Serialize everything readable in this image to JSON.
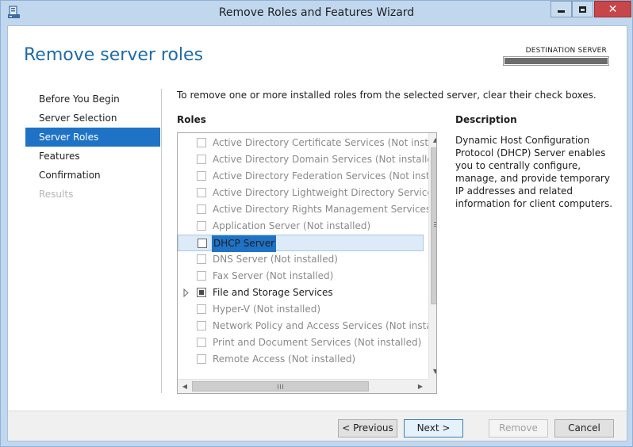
{
  "window": {
    "title": "Remove Roles and Features Wizard",
    "close_glyph": "✕"
  },
  "header": {
    "page_title": "Remove server roles",
    "destination_label": "DESTINATION SERVER"
  },
  "nav": {
    "items": [
      {
        "label": "Before You Begin",
        "state": "normal"
      },
      {
        "label": "Server Selection",
        "state": "normal"
      },
      {
        "label": "Server Roles",
        "state": "active"
      },
      {
        "label": "Features",
        "state": "normal"
      },
      {
        "label": "Confirmation",
        "state": "normal"
      },
      {
        "label": "Results",
        "state": "disabled"
      }
    ]
  },
  "main": {
    "instruction": "To remove one or more installed roles from the selected server, clear their check boxes.",
    "roles_heading": "Roles",
    "description_heading": "Description",
    "description_text": "Dynamic Host Configuration Protocol (DHCP) Server enables you to centrally configure, manage, and provide temporary IP addresses and related information for client computers."
  },
  "roles": [
    {
      "label": "Active Directory Certificate Services (Not installed)"
    },
    {
      "label": "Active Directory Domain Services (Not installed)"
    },
    {
      "label": "Active Directory Federation Services (Not installed)"
    },
    {
      "label": "Active Directory Lightweight Directory Services (N"
    },
    {
      "label": "Active Directory Rights Management Services (Not"
    },
    {
      "label": "Application Server (Not installed)"
    },
    {
      "label": "DHCP Server"
    },
    {
      "label": "DNS Server (Not installed)"
    },
    {
      "label": "Fax Server (Not installed)"
    },
    {
      "label": "File and Storage Services"
    },
    {
      "label": "Hyper-V (Not installed)"
    },
    {
      "label": "Network Policy and Access Services (Not installed)"
    },
    {
      "label": "Print and Document Services (Not installed)"
    },
    {
      "label": "Remote Access (Not installed)"
    }
  ],
  "scroll": {
    "up": "▲",
    "down": "▼",
    "left": "◀",
    "right": "▶"
  },
  "footer": {
    "previous_label": "< Previous",
    "next_label": "Next >",
    "remove_label": "Remove",
    "cancel_label": "Cancel"
  },
  "colors": {
    "accent": "#1e73c6",
    "title_blue": "#1e6ba8",
    "frame": "#c1d7ee",
    "close_red": "#c7464a"
  },
  "icons": {
    "app": "server-manager-icon",
    "expand": "triangle-right-icon"
  }
}
